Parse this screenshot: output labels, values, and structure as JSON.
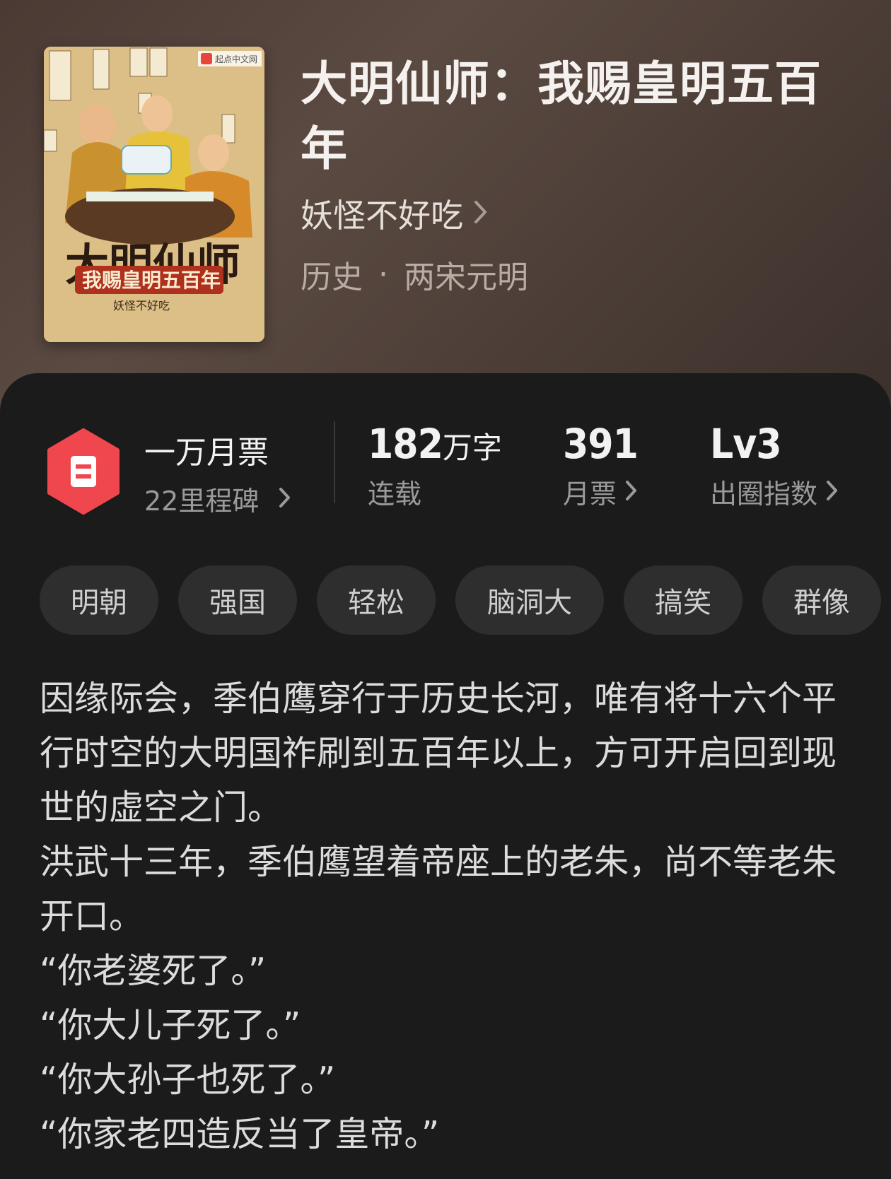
{
  "book": {
    "title": "大明仙师：我赐皇明五百年",
    "author": "妖怪不好吃",
    "category": "历史",
    "subcategory": "两宋元明",
    "separator": "·"
  },
  "cover": {
    "title_art": "大明仙师",
    "subtitle_art": "我赐皇明五百年",
    "author_art": "妖怪不好吃",
    "publisher_badge": "起点中文网"
  },
  "stats": {
    "monthly_ticket_badge": {
      "title": "一万月票",
      "subtitle": "22里程碑"
    },
    "word_count": {
      "number": "182",
      "unit": "万字",
      "label": "连载"
    },
    "monthly_tickets": {
      "number": "391",
      "label": "月票"
    },
    "breakout_index": {
      "number": "Lv3",
      "label": "出圈指数"
    }
  },
  "tags": [
    "明朝",
    "强国",
    "轻松",
    "脑洞大",
    "搞笑",
    "群像"
  ],
  "description": [
    "因缘际会，季伯鹰穿行于历史长河，唯有将十六个平行时空的大明国祚刷到五百年以上，方可开启回到现世的虚空之门。",
    "洪武十三年，季伯鹰望着帝座上的老朱，尚不等老朱开口。",
    "“你老婆死了。”",
    "“你大儿子死了。”",
    "“你大孙子也死了。”",
    "“你家老四造反当了皇帝。”"
  ],
  "colors": {
    "badge_red": "#f0474f",
    "tag_bg": "#2e2e2e",
    "card_bg": "#1b1b1b"
  }
}
